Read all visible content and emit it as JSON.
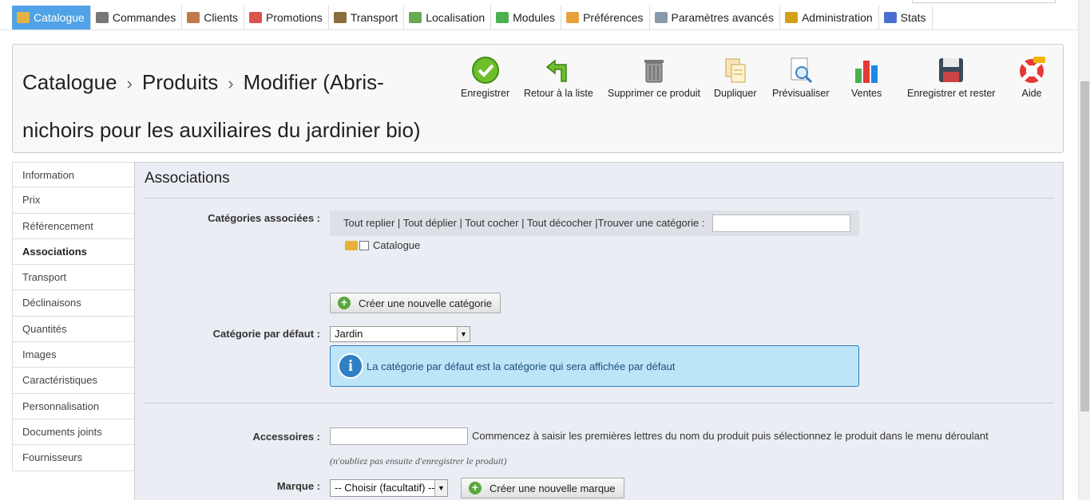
{
  "nav": {
    "tabs": [
      {
        "label": "Catalogue",
        "icon": "folder-icon",
        "color": "#e3b341"
      },
      {
        "label": "Commandes",
        "icon": "cart-icon",
        "color": "#777777"
      },
      {
        "label": "Clients",
        "icon": "user-icon",
        "color": "#c07a4a"
      },
      {
        "label": "Promotions",
        "icon": "tag-icon",
        "color": "#d9534f"
      },
      {
        "label": "Transport",
        "icon": "truck-icon",
        "color": "#8a6d3b"
      },
      {
        "label": "Localisation",
        "icon": "globe-icon",
        "color": "#6aa84f"
      },
      {
        "label": "Modules",
        "icon": "puzzle-icon",
        "color": "#4caf50"
      },
      {
        "label": "Préférences",
        "icon": "edit-icon",
        "color": "#e6a23c"
      },
      {
        "label": "Paramètres avancés",
        "icon": "wrench-icon",
        "color": "#8899aa"
      },
      {
        "label": "Administration",
        "icon": "key-icon",
        "color": "#d4a017"
      },
      {
        "label": "Stats",
        "icon": "chart-icon",
        "color": "#4a6fd1"
      }
    ]
  },
  "header": {
    "crumb1": "Catalogue",
    "crumb2": "Produits",
    "crumb3": "Modifier (Abris-nichoirs pour les auxiliaires du jardinier bio)",
    "sep": "›",
    "tools": {
      "save": "Enregistrer",
      "back": "Retour à la liste",
      "delete": "Supprimer ce produit",
      "duplicate": "Dupliquer",
      "preview": "Prévisualiser",
      "sales": "Ventes",
      "save_stay": "Enregistrer et rester",
      "help": "Aide"
    }
  },
  "sidemenu": {
    "items": [
      "Information",
      "Prix",
      "Référencement",
      "Associations",
      "Transport",
      "Déclinaisons",
      "Quantités",
      "Images",
      "Caractéristiques",
      "Personnalisation",
      "Documents joints",
      "Fournisseurs"
    ],
    "active": "Associations"
  },
  "section": {
    "title": "Associations",
    "categories_label": "Catégories associées :",
    "tree_links": {
      "collapse": "Tout replier",
      "expand": "Tout déplier",
      "check": "Tout cocher",
      "uncheck": "Tout décocher",
      "find": "Trouver une catégorie :"
    },
    "tree_root": "Catalogue",
    "new_category_button": "Créer une nouvelle catégorie",
    "default_category_label": "Catégorie par défaut :",
    "default_category_value": "Jardin",
    "info_text": "La catégorie par défaut est la catégorie qui sera affichée par défaut",
    "accessories_label": "Accessoires :",
    "accessories_hint": "Commencez à saisir les premières lettres du nom du produit puis sélectionnez le produit dans le menu déroulant",
    "accessories_note": "(n'oubliez pas ensuite d'enregistrer le produit)",
    "brand_label": "Marque :",
    "brand_value": "-- Choisir (facultatif) --",
    "new_brand_button": "Créer une nouvelle marque"
  }
}
